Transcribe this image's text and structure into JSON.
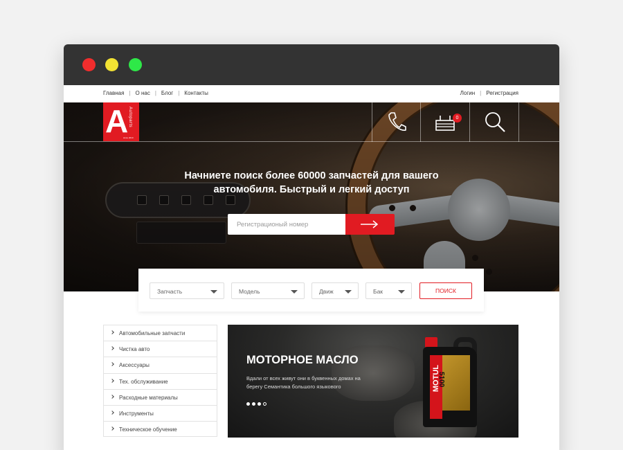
{
  "topnav": {
    "left": [
      "Главная",
      "О нас",
      "Блог",
      "Контакты"
    ],
    "right": [
      "Логин",
      "Регистрация"
    ]
  },
  "logo": {
    "letter": "A",
    "name": "Autoparts",
    "sub": "since 2010"
  },
  "header": {
    "cart_count": "0",
    "icons": [
      "phone-icon",
      "cart-icon",
      "search-icon"
    ]
  },
  "hero": {
    "headline_1": "Начниете поиск более 60000 запчастей для вашего",
    "headline_2": "автомобиля. Быстрый и легкий доступ",
    "search_placeholder": "Регистрационый номер"
  },
  "filters": {
    "part": "Запчасть",
    "model": "Модель",
    "engine": "Движ",
    "tank": "Бак",
    "search_button": "ПОИСК"
  },
  "categories": [
    "Автомобильные запчасти",
    "Чистка авто",
    "Аксессуары",
    "Тех. обслуживание",
    "Расходные материалы",
    "Инструменты",
    "Техническое обучение"
  ],
  "banner": {
    "title": "МОТОРНОЕ МАСЛО",
    "text": "Вдали от всех живут они в буквенных домах на берегу Семантика большого языкового",
    "slides_total": 4,
    "active_slide": 4,
    "bottle_brand": "MOTUL",
    "bottle_model": "5100"
  },
  "colors": {
    "accent": "#e11b22",
    "titlebar": "#333333"
  }
}
